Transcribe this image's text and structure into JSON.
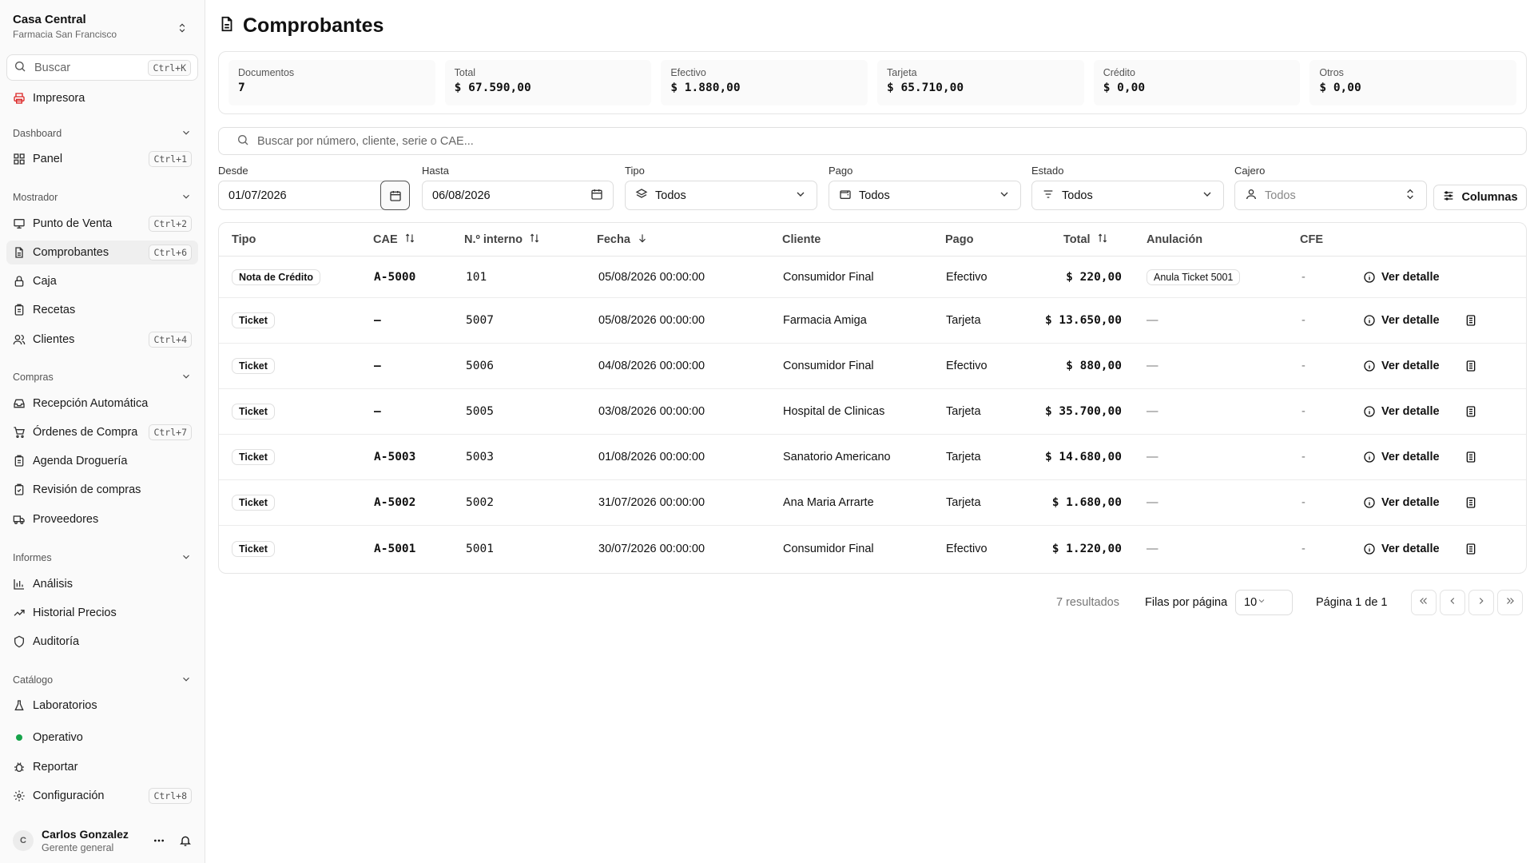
{
  "brand": {
    "title": "Casa Central",
    "subtitle": "Farmacia San Francisco"
  },
  "search": {
    "placeholder": "Buscar",
    "shortcut": "Ctrl+K"
  },
  "printer": {
    "label": "Impresora"
  },
  "sections": {
    "dashboard": "Dashboard",
    "mostrador": "Mostrador",
    "compras": "Compras",
    "informes": "Informes",
    "catalogo": "Catálogo"
  },
  "nav": {
    "panel": {
      "label": "Panel",
      "shortcut": "Ctrl+1"
    },
    "pos": {
      "label": "Punto de Venta",
      "shortcut": "Ctrl+2"
    },
    "comprobantes": {
      "label": "Comprobantes",
      "shortcut": "Ctrl+6"
    },
    "caja": {
      "label": "Caja"
    },
    "recetas": {
      "label": "Recetas"
    },
    "clientes": {
      "label": "Clientes",
      "shortcut": "Ctrl+4"
    },
    "recepcion": {
      "label": "Recepción Automática"
    },
    "ordenes": {
      "label": "Órdenes de Compra",
      "shortcut": "Ctrl+7"
    },
    "agenda": {
      "label": "Agenda Droguería"
    },
    "revision": {
      "label": "Revisión de compras"
    },
    "proveedores": {
      "label": "Proveedores"
    },
    "analisis": {
      "label": "Análisis"
    },
    "historial": {
      "label": "Historial Precios"
    },
    "auditoria": {
      "label": "Auditoría"
    },
    "laboratorios": {
      "label": "Laboratorios"
    },
    "operativo": {
      "label": "Operativo"
    },
    "reportar": {
      "label": "Reportar"
    },
    "config": {
      "label": "Configuración",
      "shortcut": "Ctrl+8"
    }
  },
  "user": {
    "initial": "C",
    "name": "Carlos Gonzalez",
    "role": "Gerente general"
  },
  "page": {
    "title": "Comprobantes"
  },
  "stats": [
    {
      "label": "Documentos",
      "value": "7"
    },
    {
      "label": "Total",
      "value": "$ 67.590,00"
    },
    {
      "label": "Efectivo",
      "value": "$ 1.880,00"
    },
    {
      "label": "Tarjeta",
      "value": "$ 65.710,00"
    },
    {
      "label": "Crédito",
      "value": "$ 0,00"
    },
    {
      "label": "Otros",
      "value": "$ 0,00"
    }
  ],
  "table_search": {
    "placeholder": "Buscar por número, cliente, serie o CAE..."
  },
  "filters": {
    "desde": {
      "label": "Desde",
      "value": "01/07/2026"
    },
    "hasta": {
      "label": "Hasta",
      "value": "06/08/2026"
    },
    "tipo": {
      "label": "Tipo",
      "value": "Todos"
    },
    "pago": {
      "label": "Pago",
      "value": "Todos"
    },
    "estado": {
      "label": "Estado",
      "value": "Todos"
    },
    "cajero": {
      "label": "Cajero",
      "value": "Todos"
    },
    "columns_label": "Columnas"
  },
  "columns": {
    "tipo": "Tipo",
    "cae": "CAE",
    "interno": "N.º interno",
    "fecha": "Fecha",
    "cliente": "Cliente",
    "pago": "Pago",
    "total": "Total",
    "anulacion": "Anulación",
    "cfe": "CFE"
  },
  "detail_label": "Ver detalle",
  "rows": [
    {
      "tipo": "Nota de Crédito",
      "cae": "A-5000",
      "interno": "101",
      "fecha": "05/08/2026 00:00:00",
      "cliente": "Consumidor Final",
      "pago": "Efectivo",
      "total": "$ 220,00",
      "anulacion": "Anula Ticket 5001",
      "cfe": "-"
    },
    {
      "tipo": "Ticket",
      "cae": "—",
      "interno": "5007",
      "fecha": "05/08/2026 00:00:00",
      "cliente": "Farmacia Amiga",
      "pago": "Tarjeta",
      "total": "$ 13.650,00",
      "anulacion": "—",
      "cfe": "-"
    },
    {
      "tipo": "Ticket",
      "cae": "—",
      "interno": "5006",
      "fecha": "04/08/2026 00:00:00",
      "cliente": "Consumidor Final",
      "pago": "Efectivo",
      "total": "$ 880,00",
      "anulacion": "—",
      "cfe": "-"
    },
    {
      "tipo": "Ticket",
      "cae": "—",
      "interno": "5005",
      "fecha": "03/08/2026 00:00:00",
      "cliente": "Hospital de Clinicas",
      "pago": "Tarjeta",
      "total": "$ 35.700,00",
      "anulacion": "—",
      "cfe": "-"
    },
    {
      "tipo": "Ticket",
      "cae": "A-5003",
      "interno": "5003",
      "fecha": "01/08/2026 00:00:00",
      "cliente": "Sanatorio Americano",
      "pago": "Tarjeta",
      "total": "$ 14.680,00",
      "anulacion": "—",
      "cfe": "-"
    },
    {
      "tipo": "Ticket",
      "cae": "A-5002",
      "interno": "5002",
      "fecha": "31/07/2026 00:00:00",
      "cliente": "Ana Maria Arrarte",
      "pago": "Tarjeta",
      "total": "$ 1.680,00",
      "anulacion": "—",
      "cfe": "-"
    },
    {
      "tipo": "Ticket",
      "cae": "A-5001",
      "interno": "5001",
      "fecha": "30/07/2026 00:00:00",
      "cliente": "Consumidor Final",
      "pago": "Efectivo",
      "total": "$ 1.220,00",
      "anulacion": "—",
      "cfe": "-"
    }
  ],
  "pagination": {
    "results": "7 resultados",
    "rows_per_page_label": "Filas por página",
    "rows_per_page": "10",
    "page_info": "Página 1 de 1"
  },
  "colors": {
    "accent_red": "#dc2626",
    "status_green": "#16a34a"
  }
}
